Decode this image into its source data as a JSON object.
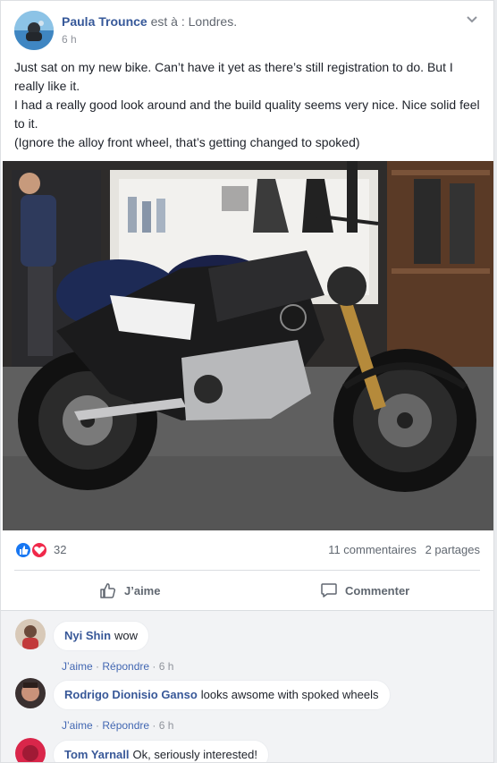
{
  "post": {
    "author": "Paula Trounce",
    "location_prefix": "est à :",
    "location": "Londres.",
    "time": "6 h",
    "text": [
      "Just sat on my new bike. Can’t have it yet as there’s still registration to do. But I really like it.",
      "I had a really good look around and the build quality seems very nice. Nice solid feel to it.",
      "(Ignore the alloy front wheel, that’s getting changed to spoked)"
    ]
  },
  "stats": {
    "reaction_count": "32",
    "comments": "11 commentaires",
    "shares": "2 partages"
  },
  "actions": {
    "like": "J’aime",
    "comment": "Commenter"
  },
  "comments": [
    {
      "name": "Nyi Shin",
      "text": "wow",
      "like": "J’aime",
      "reply": "Répondre",
      "time": "6 h"
    },
    {
      "name": "Rodrigo Dionisio Ganso",
      "text": "looks awsome with spoked wheels",
      "like": "J’aime",
      "reply": "Répondre",
      "time": "6 h"
    },
    {
      "name": "Tom Yarnall",
      "text": "Ok, seriously interested!",
      "like": "",
      "reply": "",
      "time": ""
    }
  ],
  "colors": {
    "link": "#365899",
    "like_reaction": "#1877f2",
    "love_reaction": "#f0284a"
  },
  "icons": {
    "chevron": "chevron-down-icon",
    "like": "thumbs-up-icon",
    "comment": "speech-bubble-icon"
  }
}
